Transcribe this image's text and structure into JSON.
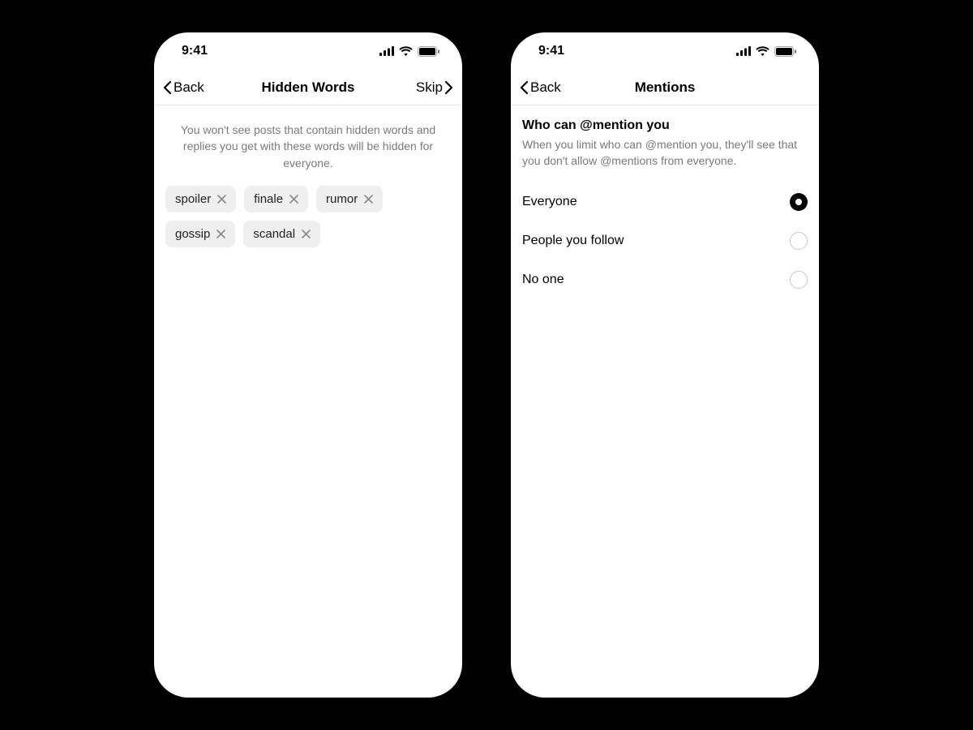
{
  "status": {
    "time": "9:41"
  },
  "phone1": {
    "nav": {
      "back": "Back",
      "title": "Hidden Words",
      "skip": "Skip"
    },
    "description": "You won't see posts that contain hidden words and replies you get with these words will be hidden for everyone.",
    "chips": [
      "spoiler",
      "finale",
      "rumor",
      "gossip",
      "scandal"
    ]
  },
  "phone2": {
    "nav": {
      "back": "Back",
      "title": "Mentions"
    },
    "section": {
      "heading": "Who can @mention you",
      "sub": "When you limit who can @mention you, they'll see that you don't allow @mentions from everyone."
    },
    "options": [
      {
        "label": "Everyone",
        "selected": true
      },
      {
        "label": "People you follow",
        "selected": false
      },
      {
        "label": "No one",
        "selected": false
      }
    ]
  }
}
